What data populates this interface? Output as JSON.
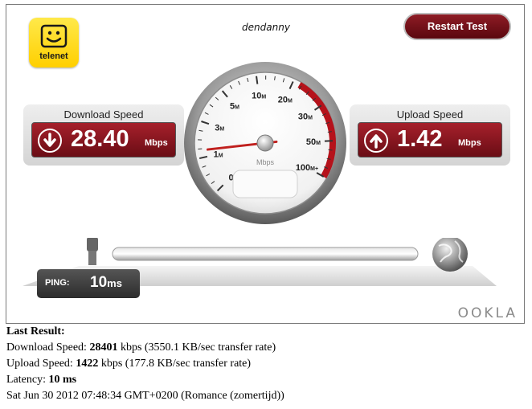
{
  "logo": {
    "text": "telenet",
    "icon": "smiley-icon"
  },
  "user": {
    "name": "dendanny"
  },
  "restart_label": "Restart Test",
  "download": {
    "title": "Download Speed",
    "value": "28.40",
    "unit": "Mbps",
    "icon": "arrow-down-icon"
  },
  "upload": {
    "title": "Upload Speed",
    "value": "1.42",
    "unit": "Mbps",
    "icon": "arrow-up-icon"
  },
  "gauge": {
    "unit": "Mbps",
    "tick_labels": [
      {
        "num": "0",
        "suffix": ""
      },
      {
        "num": "1",
        "suffix": "M"
      },
      {
        "num": "3",
        "suffix": "M"
      },
      {
        "num": "5",
        "suffix": "M"
      },
      {
        "num": "10",
        "suffix": "M"
      },
      {
        "num": "20",
        "suffix": "M"
      },
      {
        "num": "30",
        "suffix": "M"
      },
      {
        "num": "50",
        "suffix": "M"
      },
      {
        "num": "100",
        "suffix": "M+"
      }
    ],
    "needle_value_mbps": 1.42
  },
  "ping": {
    "label": "PING:",
    "value": "10",
    "unit": "ms"
  },
  "brand": "OOKLA",
  "results": {
    "heading": "Last Result:",
    "download_label": "Download Speed:",
    "download_kbps": "28401",
    "download_rest": "kbps (3550.1 KB/sec transfer rate)",
    "upload_label": "Upload Speed:",
    "upload_kbps": "1422",
    "upload_rest": "kbps (177.8 KB/sec transfer rate)",
    "latency_label": "Latency:",
    "latency_value": "10 ms",
    "timestamp": "Sat Jun 30 2012 07:48:34 GMT+0200 (Romance (zomertijd))"
  },
  "colors": {
    "accent_red": "#8e1c25",
    "logo_yellow": "#ffd500"
  }
}
